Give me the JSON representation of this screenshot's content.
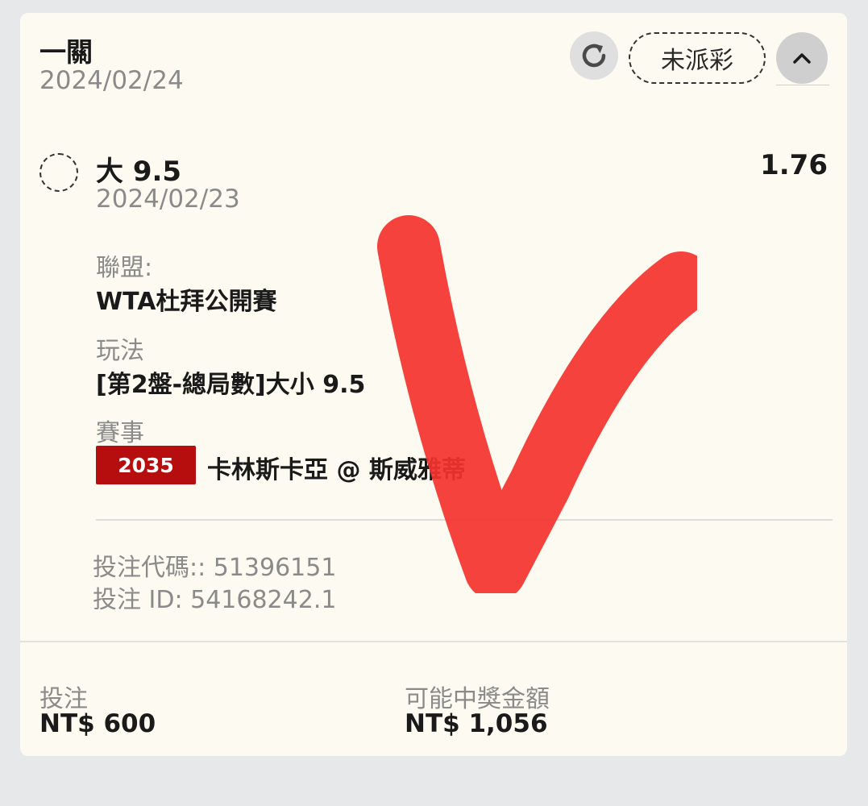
{
  "header": {
    "title": "一關",
    "date": "2024/02/24",
    "status": "未派彩",
    "refresh_icon": "refresh-icon",
    "collapse_icon": "chevron-up-icon"
  },
  "selection": {
    "name": "大 9.5",
    "odds": "1.76",
    "date": "2024/02/23",
    "league_label": "聯盟:",
    "league": "WTA杜拜公開賽",
    "market_label": "玩法",
    "market": "[第2盤-總局數]大小 9.5",
    "event_label": "賽事",
    "event_code": "2035",
    "event_name": "卡林斯卡亞 @ 斯威雅蒂"
  },
  "bet": {
    "code": "投注代碼:: 51396151",
    "id": "投注 ID: 54168242.1"
  },
  "footer": {
    "stake_label": "投注",
    "stake_value": "NT$ 600",
    "payout_label": "可能中獎金額",
    "payout_value": "NT$ 1,056"
  },
  "colors": {
    "card_bg": "#fdfbf1",
    "page_bg": "#e7e8ea",
    "event_badge": "#b60e0e",
    "check_mark": "#f5322e"
  }
}
